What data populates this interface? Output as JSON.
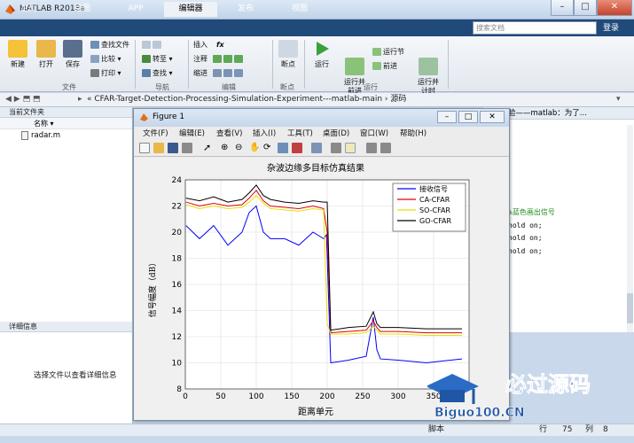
{
  "window": {
    "title": "MATLAB R2018a"
  },
  "tabs": [
    "主页",
    "绘图",
    "APP",
    "编辑器",
    "发布",
    "视图"
  ],
  "search_placeholder": "搜索文档",
  "login": "登录",
  "ribbon": {
    "file": {
      "new": "新建",
      "open": "打开",
      "save": "保存",
      "find_files": "查找文件",
      "compare": "比较",
      "print": "打印",
      "group": "文件"
    },
    "nav": {
      "goto": "转至",
      "find": "查找",
      "group": "导航"
    },
    "edit": {
      "insert": "插入",
      "fx": "fx",
      "comment": "注释",
      "indent": "缩进",
      "group": "编辑"
    },
    "breakpoints": {
      "bp": "断点",
      "group": "断点"
    },
    "run": {
      "run": "运行",
      "run_advance": "运行并\n前进",
      "run_section": "运行节",
      "advance": "前进",
      "run_time": "运行并\n计时",
      "group": "运行"
    }
  },
  "address": "« CFAR-Target-Detection-Processing-Simulation-Experiment---matlab-main › 源码",
  "current_folder": {
    "title": "当前文件夹",
    "col_name": "名称",
    "files": [
      "radar.m"
    ]
  },
  "details": {
    "title": "详细信息",
    "text": "选择文件以查看详细信息"
  },
  "editor_tab": "验——matlab：为了...",
  "editor_lines": [
    {
      "text": "%蓝色画出信号",
      "color": "#228b22"
    },
    {
      "text": "hold on;",
      "color": "#222"
    },
    {
      "text": "hold on;",
      "color": "#222"
    },
    {
      "text": "hold on;",
      "color": "#222"
    }
  ],
  "status": {
    "script": "脚本",
    "row_label": "行",
    "row": "75",
    "col_label": "列",
    "col": "8"
  },
  "figure": {
    "title": "Figure 1",
    "menu": [
      "文件(F)",
      "编辑(E)",
      "查看(V)",
      "插入(I)",
      "工具(T)",
      "桌面(D)",
      "窗口(W)",
      "帮助(H)"
    ]
  },
  "chart_data": {
    "type": "line",
    "title": "杂波边缘多目标仿真结果",
    "xlabel": "距离单元",
    "ylabel": "信号幅度（dB）",
    "xlim": [
      0,
      400
    ],
    "ylim": [
      8,
      24
    ],
    "xticks": [
      0,
      50,
      100,
      150,
      200,
      250,
      300,
      350
    ],
    "yticks": [
      8,
      10,
      12,
      14,
      16,
      18,
      20,
      22,
      24
    ],
    "grid": true,
    "legend_position": "top-right",
    "series": [
      {
        "name": "接收信号",
        "color": "#0000ff",
        "x": [
          1,
          20,
          40,
          60,
          80,
          90,
          100,
          110,
          120,
          140,
          160,
          180,
          195,
          199,
          205,
          230,
          255,
          265,
          270,
          275,
          300,
          340,
          390
        ],
        "y": [
          20.5,
          19.5,
          20.5,
          19,
          20,
          21.5,
          22,
          20,
          19.5,
          19.5,
          19,
          20,
          19.5,
          19.8,
          10,
          10.2,
          10.5,
          13.5,
          11,
          10.3,
          10.2,
          10,
          10.3
        ]
      },
      {
        "name": "CA-CFAR",
        "color": "#e00000",
        "x": [
          1,
          20,
          40,
          60,
          80,
          90,
          100,
          110,
          120,
          140,
          160,
          180,
          195,
          200,
          205,
          230,
          255,
          265,
          270,
          275,
          300,
          340,
          390
        ],
        "y": [
          22.3,
          22,
          22.2,
          22,
          22.1,
          22.6,
          23.2,
          22.4,
          22,
          21.9,
          21.8,
          22,
          21.8,
          20,
          12.3,
          12.4,
          12.5,
          13.2,
          12.7,
          12.4,
          12.4,
          12.3,
          12.3
        ]
      },
      {
        "name": "SO-CFAR",
        "color": "#e8e000",
        "x": [
          1,
          20,
          40,
          60,
          80,
          90,
          100,
          110,
          120,
          140,
          160,
          180,
          195,
          200,
          205,
          230,
          255,
          265,
          270,
          275,
          300,
          340,
          390
        ],
        "y": [
          22.1,
          21.8,
          22,
          21.8,
          21.9,
          22.3,
          22.8,
          22.2,
          21.8,
          21.7,
          21.6,
          21.8,
          21.7,
          13,
          12.2,
          12.2,
          12.3,
          12.8,
          12.5,
          12.2,
          12.2,
          12.1,
          12.1
        ]
      },
      {
        "name": "GO-CFAR",
        "color": "#000000",
        "x": [
          1,
          20,
          40,
          60,
          80,
          90,
          100,
          110,
          120,
          140,
          160,
          180,
          195,
          200,
          205,
          230,
          255,
          265,
          270,
          275,
          300,
          340,
          390
        ],
        "y": [
          22.6,
          22.4,
          22.7,
          22.3,
          22.5,
          23,
          23.6,
          22.8,
          22.5,
          22.3,
          22.2,
          22.4,
          22.3,
          22.3,
          12.5,
          12.7,
          12.8,
          13.9,
          13,
          12.7,
          12.7,
          12.6,
          12.6
        ]
      }
    ]
  },
  "watermark": {
    "brand": "必过源码",
    "url": "Biguo100.CN"
  }
}
